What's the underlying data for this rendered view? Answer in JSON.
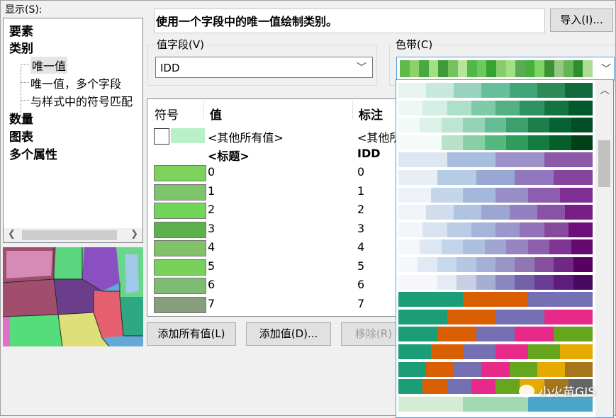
{
  "show_label": "显示(S):",
  "tree": {
    "items": [
      "要素",
      "类别",
      "数量",
      "图表",
      "多个属性"
    ],
    "sub_items": [
      "唯一值",
      "唯一值，多个字段",
      "与样式中的符号匹配"
    ]
  },
  "description": "使用一个字段中的唯一值绘制类别。",
  "import_button": "导入(I)...",
  "value_field": {
    "label": "值字段(V)",
    "value": "IDD"
  },
  "color_ramp": {
    "label": "色带(C)",
    "selected_colors": [
      "#5fba4a",
      "#8fd06a",
      "#49a840",
      "#9fe080",
      "#3f9a3a",
      "#73c25b",
      "#b4e59a",
      "#50b848",
      "#6dc95e",
      "#35a42e",
      "#87cd6e",
      "#a0e082",
      "#5aac54",
      "#46b03c",
      "#7fd362",
      "#3d9235",
      "#95c884",
      "#64b652",
      "#2d8f2a",
      "#aedc96"
    ]
  },
  "table": {
    "headers": {
      "symbol": "符号",
      "value": "值",
      "label": "标注"
    },
    "other_values": {
      "value": "<其他所有值>",
      "label": "<其他所有值>",
      "color": "#b8f0c8"
    },
    "heading_row": {
      "value": "<标题>",
      "label": "IDD"
    },
    "rows": [
      {
        "value": "0",
        "label": "0",
        "color": "#7cd25b"
      },
      {
        "value": "1",
        "label": "1",
        "color": "#7ec46d"
      },
      {
        "value": "2",
        "label": "2",
        "color": "#6fd65a"
      },
      {
        "value": "3",
        "label": "3",
        "color": "#5cb24a"
      },
      {
        "value": "4",
        "label": "4",
        "color": "#82c266"
      },
      {
        "value": "5",
        "label": "5",
        "color": "#79d05a"
      },
      {
        "value": "6",
        "label": "6",
        "color": "#7fbc73"
      },
      {
        "value": "7",
        "label": "7",
        "color": "#889f7e"
      }
    ]
  },
  "buttons": {
    "add_all": "添加所有值(L)",
    "add_values": "添加值(D)...",
    "remove": "移除(R)"
  },
  "ramp_list": [
    [
      "#e8f5ee",
      "#c7e9dc",
      "#98d4bd",
      "#66bf9a",
      "#3fa677",
      "#2b8a55",
      "#11683a"
    ],
    [
      "#eef8f3",
      "#d3eee3",
      "#ade0cb",
      "#7fcaa8",
      "#52b083",
      "#2e9361",
      "#14743f",
      "#005a2b"
    ],
    [
      "#f2faf6",
      "#dcf1e7",
      "#bde6d2",
      "#94d3b6",
      "#67bd93",
      "#3e9f6d",
      "#1c7f4a",
      "#056233",
      "#004f27"
    ],
    [
      "#f5fbf8",
      "#f5fbf8",
      "#b7e2c8",
      "#88cfa5",
      "#55b87e",
      "#2e9c5a",
      "#137d3e",
      "#055f2a",
      "#003f18"
    ],
    [
      "#dde7f2",
      "#a8bedf",
      "#9b90c8",
      "#8c5aa9"
    ],
    [
      "#e8eef6",
      "#b6cbe4",
      "#99a7d3",
      "#9177be",
      "#86449f"
    ],
    [
      "#edf2f8",
      "#c5d6ea",
      "#a4b8dc",
      "#978ec7",
      "#8d5daf",
      "#7f2f94"
    ],
    [
      "#f0f4f9",
      "#d0dded",
      "#b0c4e2",
      "#9da6d3",
      "#9280c0",
      "#8952a6",
      "#781e87"
    ],
    [
      "#f2f6fa",
      "#d8e3f0",
      "#bbcde6",
      "#a5b4da",
      "#9b97ca",
      "#9271b7",
      "#87499c",
      "#6e0f7b"
    ],
    [
      "#f3f7fb",
      "#dde8f2",
      "#c3d5ea",
      "#acc0df",
      "#a0a4d1",
      "#9684c0",
      "#8c60ab",
      "#7f3592",
      "#640a6e"
    ],
    [
      "#f5f8fb",
      "#e1eaf3",
      "#c9d9ec",
      "#b3c6e2",
      "#a4b0d6",
      "#9a95c7",
      "#9176b6",
      "#884f9f",
      "#702886",
      "#5a0064"
    ],
    [
      "#f5f7fa",
      "#f5f7fa",
      "#e6eaf2",
      "#c8cfe4",
      "#a6aed4",
      "#8a86c0",
      "#7461a8",
      "#6a3c94",
      "#5e1c7c",
      "#480a60"
    ],
    [
      "#1b9e77",
      "#d95f02",
      "#7570b3"
    ],
    [
      "#1b9e77",
      "#d95f02",
      "#7570b3",
      "#e7298a"
    ],
    [
      "#1b9e77",
      "#d95f02",
      "#7570b3",
      "#e7298a",
      "#66a61e"
    ],
    [
      "#1b9e77",
      "#d95f02",
      "#7570b3",
      "#e7298a",
      "#66a61e",
      "#e6ab02"
    ],
    [
      "#1b9e77",
      "#d95f02",
      "#7570b3",
      "#e7298a",
      "#66a61e",
      "#e6ab02",
      "#a6761d"
    ],
    [
      "#1b9e77",
      "#d95f02",
      "#7570b3",
      "#e7298a",
      "#66a61e",
      "#e6ab02",
      "#a6761d",
      "#666666"
    ],
    [
      "#d4ecd6",
      "#a1dab2",
      "#4aa6c8"
    ]
  ],
  "watermark": "小火苗GIS"
}
